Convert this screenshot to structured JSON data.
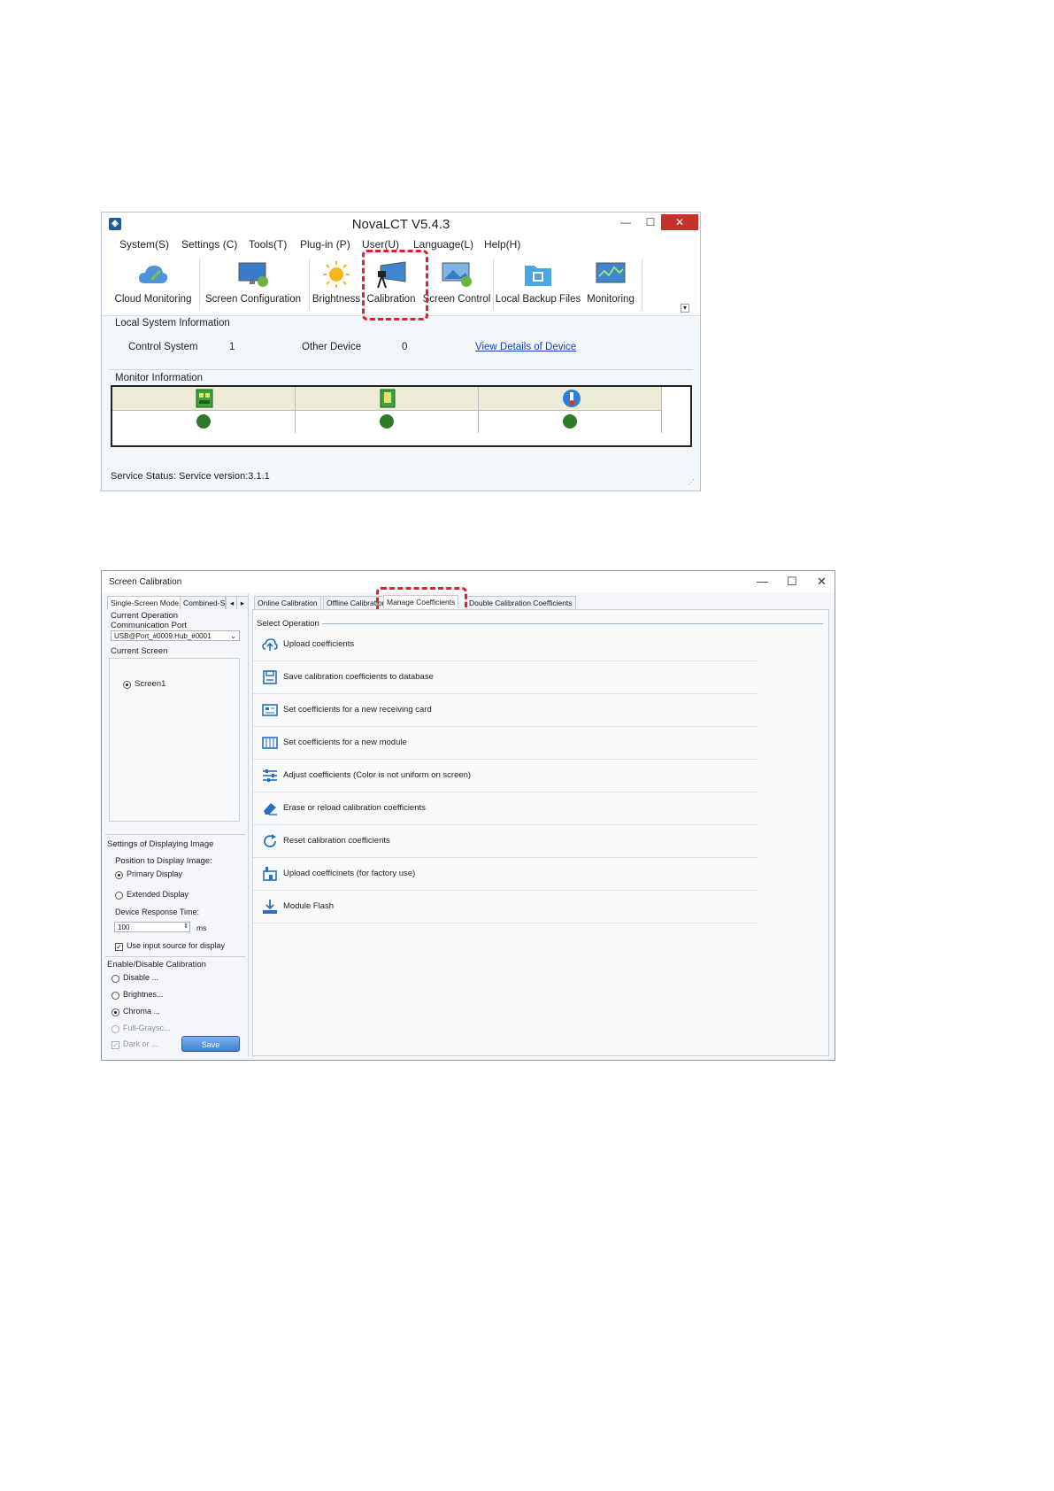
{
  "window1": {
    "title": "NovaLCT V5.4.3",
    "menu": [
      "System(S)",
      "Settings (C)",
      "Tools(T)",
      "Plug-in (P)",
      "User(U)",
      "Language(L)",
      "Help(H)"
    ],
    "toolbar": [
      "Cloud Monitoring",
      "Screen Configuration",
      "Brightness",
      "Calibration",
      "Screen Control",
      "Local Backup Files",
      "Monitoring"
    ],
    "local_system_info_label": "Local System Information",
    "control_system_label": "Control System",
    "control_system_value": "1",
    "other_device_label": "Other Device",
    "other_device_value": "0",
    "view_details_link": "View Details of Device",
    "monitor_info_label": "Monitor Information",
    "service_status": "Service Status:  Service version:3.1.1",
    "colors": {
      "close": "#c8312b",
      "highlight": "#e0202a",
      "status_ok": "#2f7a2a",
      "link": "#1a3fbf"
    }
  },
  "window2": {
    "title": "Screen Calibration",
    "left_tabs": [
      "Single-Screen Mode",
      "Combined-Sc"
    ],
    "tabs": [
      "Online Calibration",
      "Offline Calibration",
      "Manage Coefficients",
      "Double Calibration Coefficients"
    ],
    "current_operation_label": "Current Operation",
    "communication_port_label": "Communication Port",
    "communication_port_value": "USB@Port_#0009.Hub_#0001",
    "current_screen_label": "Current Screen",
    "screen_option": "Screen1",
    "settings_display_label": "Settings of Displaying Image",
    "position_label": "Position to Display Image:",
    "primary_display": "Primary Display",
    "extended_display": "Extended Display",
    "response_time_label": "Device Response Time:",
    "response_time_value": "100",
    "response_time_unit": "ms",
    "use_input_source": "Use input source for display",
    "enable_disable_label": "Enable/Disable Calibration",
    "calib_options": [
      "Disable ...",
      "Brightnes...",
      "Chroma ...",
      "Full-Graysc...",
      "Dark or ..."
    ],
    "save_button": "Save",
    "select_operation_label": "Select Operation",
    "operations": [
      {
        "label": "Upload coefficients",
        "icon": "cloud-upload-icon"
      },
      {
        "label": "Save calibration coefficients to database",
        "icon": "save-icon"
      },
      {
        "label": "Set coefficients for a new receiving card",
        "icon": "card-icon"
      },
      {
        "label": "Set coefficients for a new module",
        "icon": "module-grid-icon"
      },
      {
        "label": "Adjust coefficients (Color is not uniform on screen)",
        "icon": "sliders-icon"
      },
      {
        "label": "Erase or reload calibration coefficients",
        "icon": "eraser-icon"
      },
      {
        "label": "Reset calibration coefficients",
        "icon": "reset-icon"
      },
      {
        "label": "Upload coefficinets (for factory use)",
        "icon": "factory-upload-icon"
      },
      {
        "label": "Module Flash",
        "icon": "download-icon"
      }
    ]
  }
}
